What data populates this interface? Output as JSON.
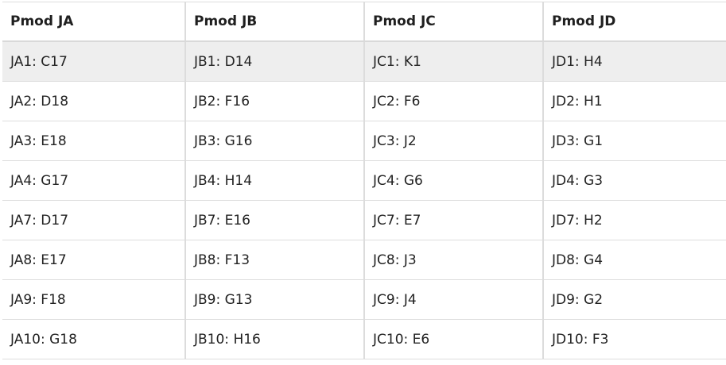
{
  "table": {
    "headers": [
      "Pmod JA",
      "Pmod JB",
      "Pmod JC",
      "Pmod JD"
    ],
    "rows": [
      [
        "JA1: C17",
        "JB1: D14",
        "JC1: K1",
        "JD1: H4"
      ],
      [
        "JA2: D18",
        "JB2: F16",
        "JC2: F6",
        "JD2: H1"
      ],
      [
        "JA3: E18",
        "JB3: G16",
        "JC3: J2",
        "JD3: G1"
      ],
      [
        "JA4: G17",
        "JB4: H14",
        "JC4: G6",
        "JD4: G3"
      ],
      [
        "JA7: D17",
        "JB7: E16",
        "JC7: E7",
        "JD7: H2"
      ],
      [
        "JA8: E17",
        "JB8: F13",
        "JC8: J3",
        "JD8: G4"
      ],
      [
        "JA9: F18",
        "JB9: G13",
        "JC9: J4",
        "JD9: G2"
      ],
      [
        "JA10: G18",
        "JB10: H16",
        "JC10: E6",
        "JD10: F3"
      ]
    ]
  },
  "colors": {
    "highlight_row": "#eeeeee",
    "border": "#dddddd",
    "text": "#222222"
  }
}
